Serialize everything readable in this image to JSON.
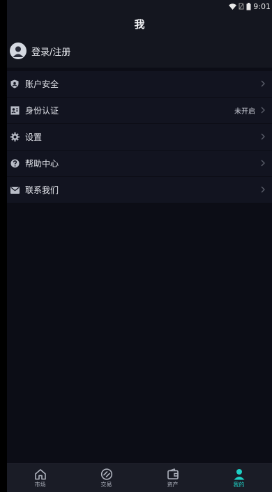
{
  "status_bar": {
    "time": "9:01"
  },
  "header": {
    "title": "我"
  },
  "user": {
    "login_label": "登录/注册"
  },
  "menu": [
    {
      "label": "账户安全",
      "value": "",
      "icon": "shield-user-icon"
    },
    {
      "label": "身份认证",
      "value": "未开启",
      "icon": "id-card-icon"
    },
    {
      "label": "设置",
      "value": "",
      "icon": "gear-icon"
    },
    {
      "label": "帮助中心",
      "value": "",
      "icon": "help-icon"
    },
    {
      "label": "联系我们",
      "value": "",
      "icon": "mail-icon"
    }
  ],
  "tabs": [
    {
      "label": "市场",
      "icon": "home-icon",
      "active": false
    },
    {
      "label": "交易",
      "icon": "exchange-icon",
      "active": false
    },
    {
      "label": "资产",
      "icon": "wallet-icon",
      "active": false
    },
    {
      "label": "我的",
      "icon": "user-icon",
      "active": true
    }
  ],
  "colors": {
    "accent": "#1ecfc4",
    "background": "#0c0d16",
    "row": "#121420"
  }
}
